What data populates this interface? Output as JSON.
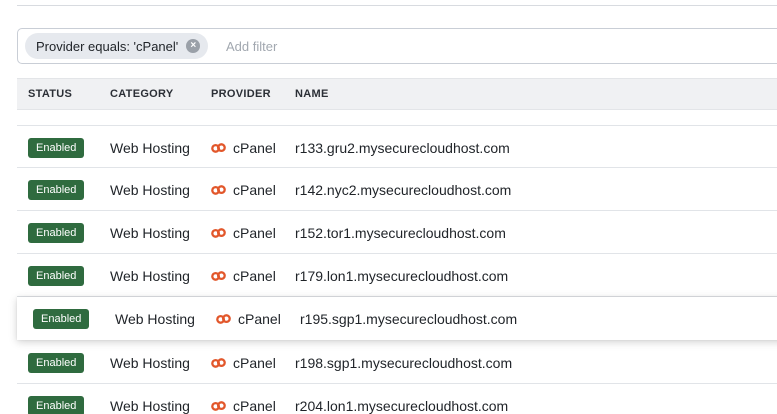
{
  "filter": {
    "chip_label": "Provider equals: 'cPanel'",
    "remove_glyph": "×",
    "placeholder": "Add filter"
  },
  "table": {
    "columns": [
      "STATUS",
      "CATEGORY",
      "PROVIDER",
      "NAME"
    ],
    "rows": [
      {
        "status": "Enabled",
        "category": "Web Hosting",
        "provider": "cPanel",
        "name": "r133.gru2.mysecurecloudhost.com"
      },
      {
        "status": "Enabled",
        "category": "Web Hosting",
        "provider": "cPanel",
        "name": "r142.nyc2.mysecurecloudhost.com"
      },
      {
        "status": "Enabled",
        "category": "Web Hosting",
        "provider": "cPanel",
        "name": "r152.tor1.mysecurecloudhost.com"
      },
      {
        "status": "Enabled",
        "category": "Web Hosting",
        "provider": "cPanel",
        "name": "r179.lon1.mysecurecloudhost.com"
      },
      {
        "status": "Enabled",
        "category": "Web Hosting",
        "provider": "cPanel",
        "name": "r195.sgp1.mysecurecloudhost.com"
      },
      {
        "status": "Enabled",
        "category": "Web Hosting",
        "provider": "cPanel",
        "name": "r198.sgp1.mysecurecloudhost.com"
      },
      {
        "status": "Enabled",
        "category": "Web Hosting",
        "provider": "cPanel",
        "name": "r204.lon1.mysecurecloudhost.com"
      }
    ]
  },
  "provider_icon": "cpanel-logo-icon",
  "colors": {
    "enabled_badge": "#2f6b3f",
    "cpanel_brand": "#e2572b"
  }
}
